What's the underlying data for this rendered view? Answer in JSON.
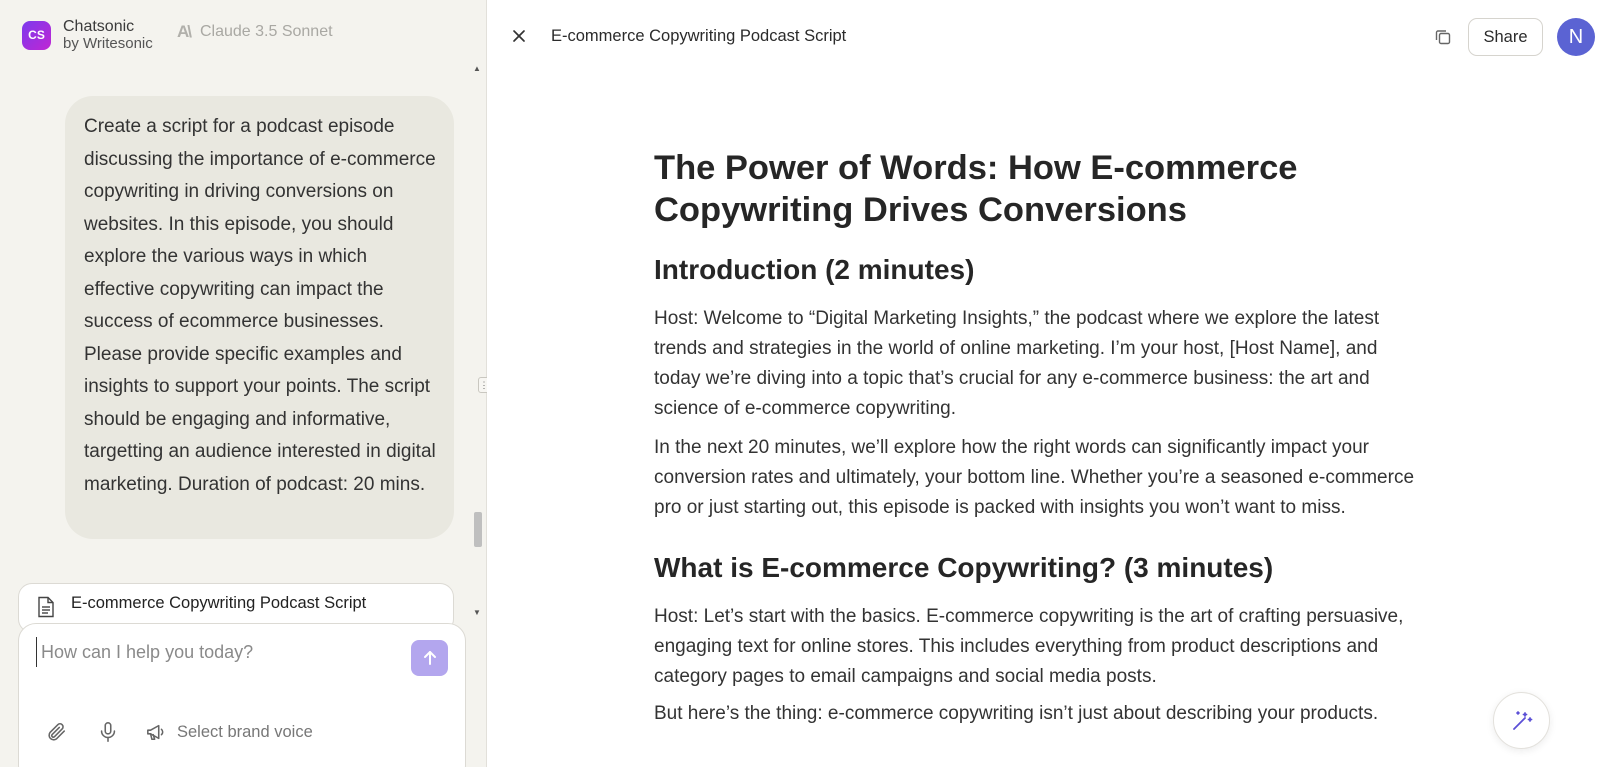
{
  "sidebar": {
    "brand_icon": "CS",
    "brand_name": "Chatsonic",
    "brand_sub": "by Writesonic",
    "model_icon": "anthropic-icon",
    "model_name": "Claude 3.5 Sonnet",
    "user_message": "Create a script for a podcast episode discussing the importance of e-commerce copywriting in driving conversions on websites. In this episode, you should explore the various ways in which effective copywriting can impact the success of ecommerce businesses. Please provide specific examples and insights to support your points. The script should be engaging and informative, targetting an audience interested in digital marketing. Duration of podcast: 20 mins.",
    "artifact_card_title": "E-commerce Copywriting Podcast Script",
    "composer": {
      "placeholder": "How can I help you today?",
      "value": "",
      "brand_voice_label": "Select brand voice"
    }
  },
  "artifact": {
    "title": "E-commerce Copywriting Podcast Script",
    "share_label": "Share",
    "avatar_initial": "N",
    "doc": {
      "h1": "The Power of Words: How E-commerce Copywriting Drives Conversions",
      "h2_intro": "Introduction (2 minutes)",
      "p1": "Host: Welcome to “Digital Marketing Insights,” the podcast where we explore the latest trends and strategies in the world of online marketing. I’m your host, [Host Name], and today we’re diving into a topic that’s crucial for any e-commerce business: the art and science of e-commerce copywriting.",
      "p2": "In the next 20 minutes, we’ll explore how the right words can significantly impact your conversion rates and ultimately, your bottom line. Whether you’re a seasoned e-commerce pro or just starting out, this episode is packed with insights you won’t want to miss.",
      "h2_what": "What is E-commerce Copywriting? (3 minutes)",
      "p3": "Host: Let’s start with the basics. E-commerce copywriting is the art of crafting persuasive, engaging text for online stores. This includes everything from product descriptions and category pages to email campaigns and social media posts.",
      "p4": "But here’s the thing: e-commerce copywriting isn’t just about describing your products."
    }
  },
  "colors": {
    "accent": "#7c3aed",
    "send_button": "#b3a6ee",
    "avatar": "#5b63d3",
    "sidebar_bg": "#f4f3ee",
    "message_bg": "#e9e8e0"
  }
}
